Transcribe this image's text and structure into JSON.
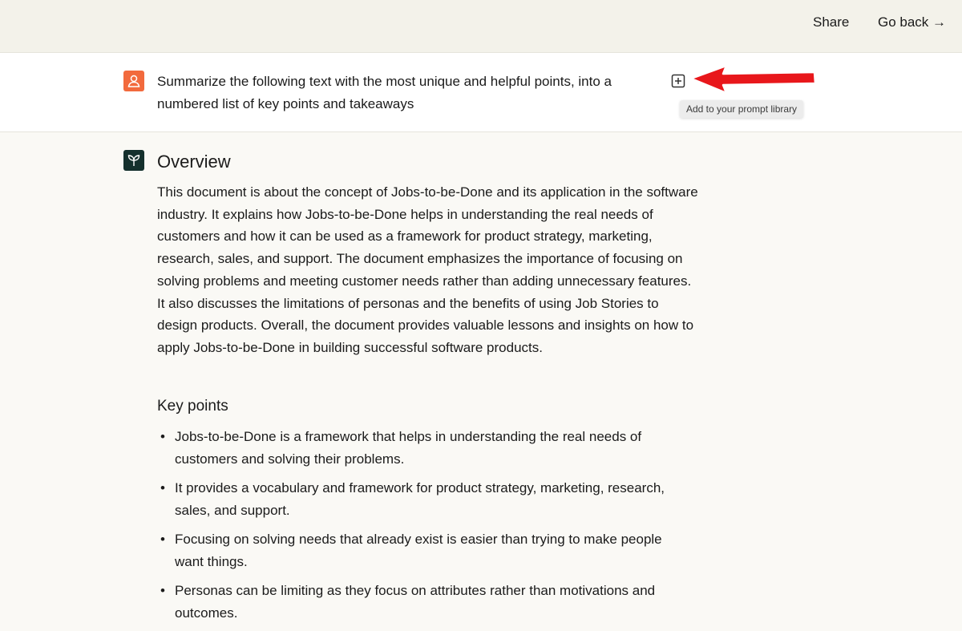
{
  "header": {
    "share_label": "Share",
    "go_back_label": "Go back →"
  },
  "prompt": {
    "text": "Summarize the following text with the most unique and helpful points, into a numbered list of key points and takeaways",
    "tooltip": "Add to your prompt library"
  },
  "response": {
    "overview_title": "Overview",
    "overview_body": "This document is about the concept of Jobs-to-be-Done and its application in the software industry. It explains how Jobs-to-be-Done helps in understanding the real needs of customers and how it can be used as a framework for product strategy, marketing, research, sales, and support. The document emphasizes the importance of focusing on solving problems and meeting customer needs rather than adding unnecessary features. It also discusses the limitations of personas and the benefits of using Job Stories to design products. Overall, the document provides valuable lessons and insights on how to apply Jobs-to-be-Done in building successful software products.",
    "key_points_title": "Key points",
    "key_points": [
      "Jobs-to-be-Done is a framework that helps in understanding the real needs of customers and solving their problems.",
      "It provides a vocabulary and framework for product strategy, marketing, research, sales, and support.",
      "Focusing on solving needs that already exist is easier than trying to make people want things.",
      "Personas can be limiting as they focus on attributes rather than motivations and outcomes."
    ]
  },
  "colors": {
    "user_avatar": "#f26a3d",
    "bot_avatar": "#14302d",
    "annotation_arrow": "#e8171b",
    "header_bg": "#f3f2ea"
  }
}
